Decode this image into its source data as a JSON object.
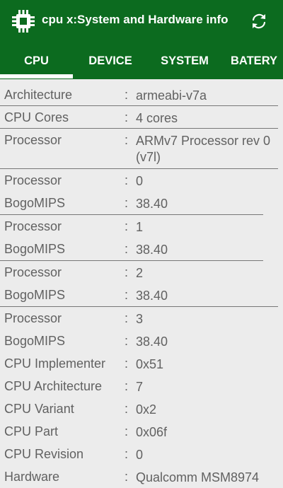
{
  "app": {
    "title": "cpu x:System and Hardware info",
    "icons": {
      "logo": "cpu-chip-icon",
      "refresh": "refresh-icon"
    },
    "colors": {
      "appbar": "#0c6b1f",
      "background": "#ececec",
      "text": "#616161",
      "tab_text": "#ffffff"
    }
  },
  "tabs": [
    {
      "label": "CPU",
      "selected": true
    },
    {
      "label": "DEVICE",
      "selected": false
    },
    {
      "label": "SYSTEM",
      "selected": false
    },
    {
      "label": "BATERY",
      "selected": false
    }
  ],
  "rows": [
    {
      "label": "Architecture",
      "value": "armeabi-v7a"
    },
    {
      "label": "CPU Cores",
      "value": "4 cores"
    },
    {
      "label": "Processor",
      "value": "ARMv7 Processor rev 0 (v7l)"
    },
    {
      "label": "Processor",
      "value": "0"
    },
    {
      "label": "BogoMIPS",
      "value": "38.40"
    },
    {
      "label": "Processor",
      "value": "1"
    },
    {
      "label": "BogoMIPS",
      "value": "38.40"
    },
    {
      "label": "Processor",
      "value": "2"
    },
    {
      "label": "BogoMIPS",
      "value": "38.40"
    },
    {
      "label": "Processor",
      "value": "3"
    },
    {
      "label": "BogoMIPS",
      "value": "38.40"
    },
    {
      "label": "CPU Implementer",
      "value": "0x51"
    },
    {
      "label": "CPU Architecture",
      "value": "7"
    },
    {
      "label": "CPU Variant",
      "value": "0x2"
    },
    {
      "label": "CPU Part",
      "value": "0x06f"
    },
    {
      "label": "CPU Revision",
      "value": "0"
    },
    {
      "label": "Hardware",
      "value": "Qualcomm MSM8974"
    }
  ],
  "separator": ":"
}
